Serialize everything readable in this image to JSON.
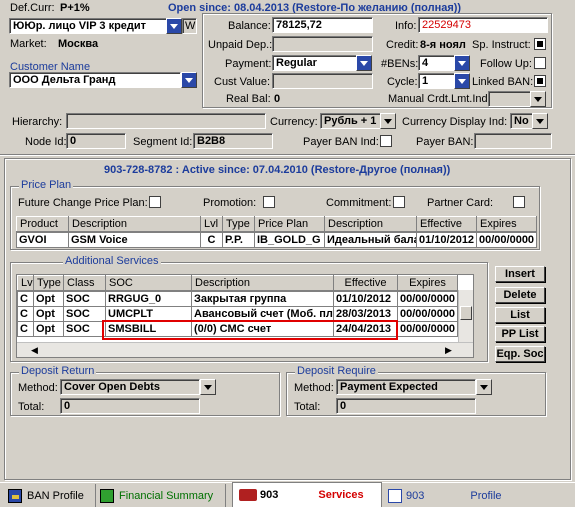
{
  "header": {
    "def_curr_label": "Def.Curr:",
    "def_curr_value": "P+1%",
    "open_since": "Open since: 08.04.2013 (Restore-По желанию (полная))",
    "account_type": "ЮЮр. лицо VIP 3  кредит",
    "w_label": "W",
    "market_label": "Market:",
    "market_value": "Москва",
    "customer_name_label": "Customer Name",
    "customer_name_value": "ООО Дельта Гранд"
  },
  "balance_panel": {
    "balance_label": "Balance:",
    "balance_value": "78125,72",
    "unpaid_label": "Unpaid Dep.:",
    "unpaid_value": "",
    "payment_label": "Payment:",
    "payment_value": "Regular",
    "cust_value_label": "Cust Value:",
    "cust_value_value": "",
    "real_bal_label": "Real Bal:",
    "real_bal_value": "0",
    "info_label": "Info:",
    "info_value": "22529473",
    "credit_label": "Credit:",
    "credit_value": "8-я ноял",
    "sp_instruct_label": "Sp. Instruct:",
    "bens_label": "#BENs:",
    "bens_value": "4",
    "follow_up_label": "Follow Up:",
    "cycle_label": "Cycle:",
    "cycle_value": "1",
    "linked_ban_label": "Linked BAN:",
    "manual_label": "Manual Crdt.Lmt.Ind:",
    "manual_value": ""
  },
  "hierarchy": {
    "hierarchy_label": "Hierarchy:",
    "hierarchy_value": "",
    "currency_label": "Currency:",
    "currency_value": "Рубль + 1",
    "currency_display_label": "Currency Display Ind:",
    "currency_display_value": "No",
    "node_id_label": "Node Id:",
    "node_id_value": "0",
    "segment_id_label": "Segment Id:",
    "segment_id_value": "B2B8",
    "payer_ban_ind_label": "Payer BAN Ind:",
    "payer_ban_label": "Payer BAN:",
    "payer_ban_value": ""
  },
  "subscriber": {
    "title": "903-728-8782 : Active since: 07.04.2010 (Restore-Другое (полная))"
  },
  "price_plan": {
    "group_title": "Price Plan",
    "future_change_label": "Future Change Price Plan:",
    "promotion_label": "Promotion:",
    "commitment_label": "Commitment:",
    "partner_card_label": "Partner Card:",
    "columns": [
      "Product",
      "Description",
      "Lvl",
      "Type",
      "Price Plan",
      "Description",
      "Effective",
      "Expires"
    ],
    "row": [
      "GVOI",
      "GSM Voice",
      "C",
      "P.P.",
      "IB_GOLD_G",
      "Идеальный бала",
      "01/10/2012",
      "00/00/0000"
    ]
  },
  "additional_services": {
    "group_title": "Additional Services",
    "columns": [
      "Lvl",
      "Type",
      "Class",
      "SOC",
      "Description",
      "Effective",
      "Expires"
    ],
    "rows": [
      [
        "C",
        "Opt",
        "SOC",
        "RRGUG_0",
        "Закрытая группа",
        "01/10/2012",
        "00/00/0000"
      ],
      [
        "C",
        "Opt",
        "SOC",
        "UMCPLT",
        "Авансовый счет (Моб. пл",
        "28/03/2013",
        "00/00/0000"
      ],
      [
        "C",
        "Opt",
        "SOC",
        "SMSBILL",
        "(0/0) СМС счет",
        "24/04/2013",
        "00/00/0000"
      ]
    ],
    "buttons": {
      "insert": "Insert",
      "delete": "Delete",
      "list": "List",
      "pp_list": "PP List",
      "eqp_soc": "Eqp. Soc"
    }
  },
  "deposit_return": {
    "group_title": "Deposit Return",
    "method_label": "Method:",
    "method_value": "Cover Open Debts",
    "total_label": "Total:",
    "total_value": "0"
  },
  "deposit_require": {
    "group_title": "Deposit Require",
    "method_label": "Method:",
    "method_value": "Payment Expected",
    "total_label": "Total:",
    "total_value": "0"
  },
  "tabs": {
    "ban_profile": "BAN Profile",
    "financial_summary": "Financial Summary",
    "subscriber_number": "903",
    "services": "Services",
    "profile_number": "903",
    "profile": "Profile"
  },
  "colors": {
    "window_bg": "#d4d0c8",
    "title_blue": "#1c3c9c",
    "alert_red": "#d40000",
    "highlight_red": "#e00000",
    "financial_green": "#007000"
  }
}
